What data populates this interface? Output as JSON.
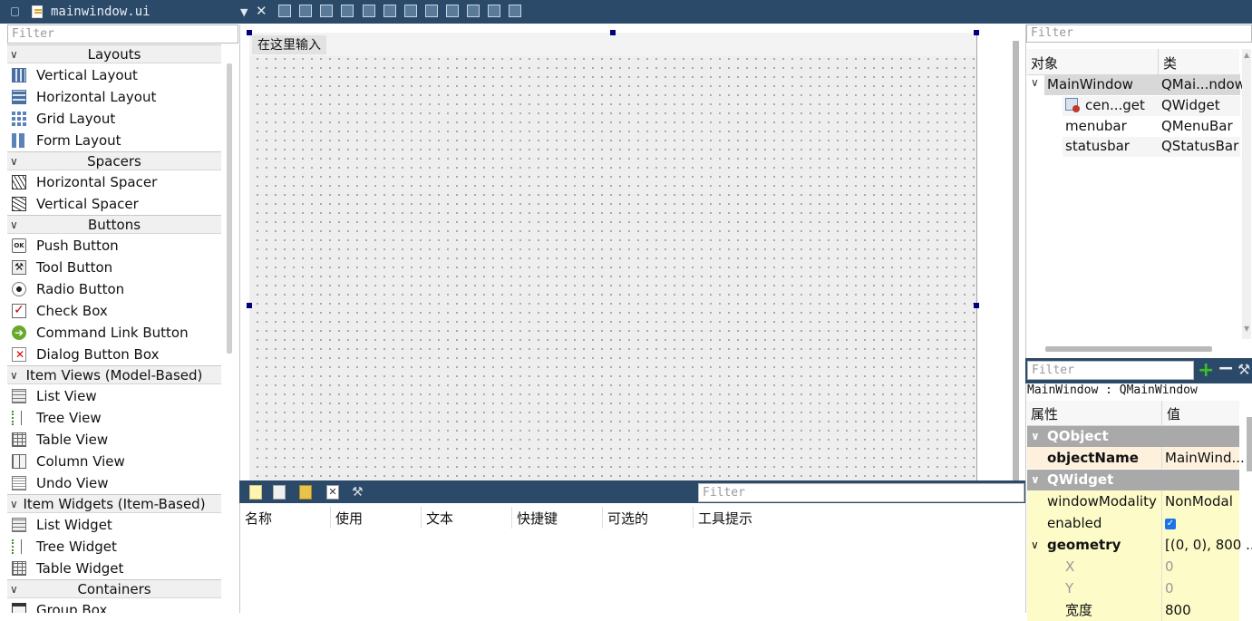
{
  "app": {
    "file_title": "mainwindow.ui"
  },
  "widget_box": {
    "filter_placeholder": "Filter",
    "categories": [
      {
        "label": "Layouts",
        "items": [
          "Vertical Layout",
          "Horizontal Layout",
          "Grid Layout",
          "Form Layout"
        ],
        "icons": [
          "vertical-layout-icon",
          "horizontal-layout-icon",
          "grid-layout-icon",
          "form-layout-icon"
        ]
      },
      {
        "label": "Spacers",
        "items": [
          "Horizontal Spacer",
          "Vertical Spacer"
        ],
        "icons": [
          "horizontal-spacer-icon",
          "vertical-spacer-icon"
        ]
      },
      {
        "label": "Buttons",
        "items": [
          "Push Button",
          "Tool Button",
          "Radio Button",
          "Check Box",
          "Command Link Button",
          "Dialog Button Box"
        ],
        "icons": [
          "push-button-icon",
          "tool-button-icon",
          "radio-button-icon",
          "check-box-icon",
          "command-link-icon",
          "dialog-button-box-icon"
        ]
      },
      {
        "label": "Item Views (Model-Based)",
        "items": [
          "List View",
          "Tree View",
          "Table View",
          "Column View",
          "Undo View"
        ],
        "icons": [
          "list-view-icon",
          "tree-view-icon",
          "table-view-icon",
          "column-view-icon",
          "undo-view-icon"
        ]
      },
      {
        "label": "Item Widgets (Item-Based)",
        "items": [
          "List Widget",
          "Tree Widget",
          "Table Widget"
        ],
        "icons": [
          "list-widget-icon",
          "tree-widget-icon",
          "table-widget-icon"
        ]
      },
      {
        "label": "Containers",
        "items": [
          "Group Box"
        ],
        "icons": [
          "group-box-icon"
        ]
      }
    ]
  },
  "form": {
    "menu_placeholder": "在这里输入"
  },
  "action_editor": {
    "filter_placeholder": "Filter",
    "columns": [
      "名称",
      "使用",
      "文本",
      "快捷键",
      "可选的",
      "工具提示"
    ]
  },
  "object_inspector": {
    "filter_placeholder": "Filter",
    "headers": [
      "对象",
      "类"
    ],
    "rows": [
      {
        "name": "MainWindow",
        "class": "QMai...ndow"
      },
      {
        "name": "cen...get",
        "class": "QWidget"
      },
      {
        "name": "menubar",
        "class": "QMenuBar"
      },
      {
        "name": "statusbar",
        "class": "QStatusBar"
      }
    ]
  },
  "property_editor": {
    "filter_placeholder": "Filter",
    "class_label": "MainWindow : QMainWindow",
    "headers": [
      "属性",
      "值"
    ],
    "groups": [
      "QObject",
      "QWidget"
    ],
    "props": {
      "objectName": {
        "key": "objectName",
        "value": "MainWind..."
      },
      "windowModality": {
        "key": "windowModality",
        "value": "NonModal"
      },
      "enabled": {
        "key": "enabled",
        "value": "✓"
      },
      "geometry": {
        "key": "geometry",
        "value": "[(0, 0), 800 ..."
      },
      "x": {
        "key": "X",
        "value": "0"
      },
      "y": {
        "key": "Y",
        "value": "0"
      },
      "width": {
        "key": "宽度",
        "value": "800"
      }
    },
    "colors": {
      "group_bg": "#a9a9a9",
      "object_row_bg": "#fdf0dc",
      "widget_row_bg": "#fdfbc8"
    }
  },
  "theme": {
    "titlebar": "#2b4a69",
    "accent_check": "#1a73e8"
  }
}
